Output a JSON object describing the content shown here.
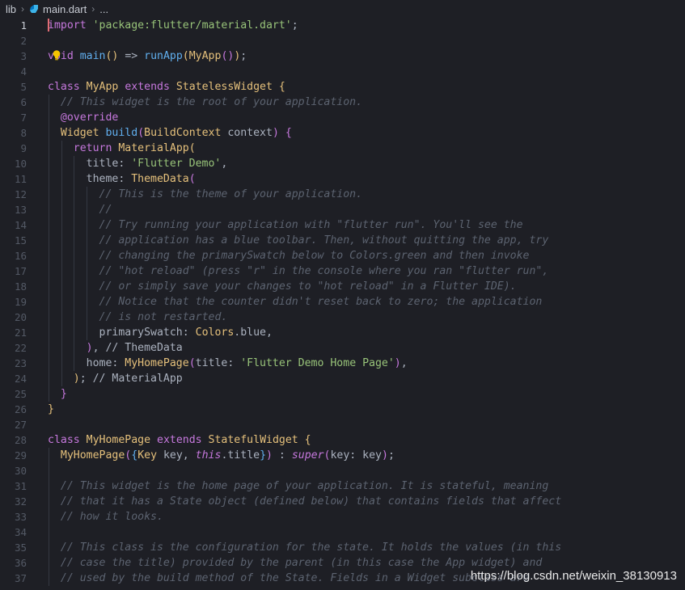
{
  "breadcrumb": {
    "folder": "lib",
    "file": "main.dart",
    "more": "..."
  },
  "editor": {
    "active_line": 1,
    "lines": [
      {
        "n": "1",
        "indent": 0,
        "tokens": [
          [
            "kw",
            "import"
          ],
          [
            "pl",
            " "
          ],
          [
            "str",
            "'package:flutter/material.dart'"
          ],
          [
            "pl",
            ";"
          ]
        ]
      },
      {
        "n": "2",
        "indent": 0,
        "tokens": []
      },
      {
        "n": "3",
        "indent": 0,
        "tokens": [
          [
            "kw",
            "void"
          ],
          [
            "pl",
            " "
          ],
          [
            "fn",
            "main"
          ],
          [
            "brk",
            "()"
          ],
          [
            "pl",
            " => "
          ],
          [
            "fn",
            "runApp"
          ],
          [
            "brk",
            "("
          ],
          [
            "cls",
            "MyApp"
          ],
          [
            "brk2",
            "()"
          ],
          [
            "brk",
            ")"
          ],
          [
            "pl",
            ";"
          ]
        ]
      },
      {
        "n": "4",
        "indent": 0,
        "tokens": []
      },
      {
        "n": "5",
        "indent": 0,
        "tokens": [
          [
            "kw",
            "class"
          ],
          [
            "pl",
            " "
          ],
          [
            "cls",
            "MyApp"
          ],
          [
            "pl",
            " "
          ],
          [
            "kw",
            "extends"
          ],
          [
            "pl",
            " "
          ],
          [
            "cls",
            "StatelessWidget"
          ],
          [
            "pl",
            " "
          ],
          [
            "brk",
            "{"
          ]
        ]
      },
      {
        "n": "6",
        "indent": 1,
        "tokens": [
          [
            "cm",
            "// This widget is the root of your application."
          ]
        ]
      },
      {
        "n": "7",
        "indent": 1,
        "tokens": [
          [
            "ann",
            "@override"
          ]
        ]
      },
      {
        "n": "8",
        "indent": 1,
        "tokens": [
          [
            "cls",
            "Widget"
          ],
          [
            "pl",
            " "
          ],
          [
            "fn",
            "build"
          ],
          [
            "brk2",
            "("
          ],
          [
            "cls",
            "BuildContext"
          ],
          [
            "pl",
            " context"
          ],
          [
            "brk2",
            ")"
          ],
          [
            "pl",
            " "
          ],
          [
            "brk2",
            "{"
          ]
        ]
      },
      {
        "n": "9",
        "indent": 2,
        "tokens": [
          [
            "kw",
            "return"
          ],
          [
            "pl",
            " "
          ],
          [
            "cls",
            "MaterialApp"
          ],
          [
            "brk",
            "("
          ]
        ]
      },
      {
        "n": "10",
        "indent": 3,
        "tokens": [
          [
            "pl",
            "title: "
          ],
          [
            "str",
            "'Flutter Demo'"
          ],
          [
            "pl",
            ","
          ]
        ]
      },
      {
        "n": "11",
        "indent": 3,
        "tokens": [
          [
            "pl",
            "theme: "
          ],
          [
            "cls",
            "ThemeData"
          ],
          [
            "brk2",
            "("
          ]
        ]
      },
      {
        "n": "12",
        "indent": 4,
        "tokens": [
          [
            "cm",
            "// This is the theme of your application."
          ]
        ]
      },
      {
        "n": "13",
        "indent": 4,
        "tokens": [
          [
            "cm",
            "//"
          ]
        ]
      },
      {
        "n": "14",
        "indent": 4,
        "tokens": [
          [
            "cm",
            "// Try running your application with \"flutter run\". You'll see the"
          ]
        ]
      },
      {
        "n": "15",
        "indent": 4,
        "tokens": [
          [
            "cm",
            "// application has a blue toolbar. Then, without quitting the app, try"
          ]
        ]
      },
      {
        "n": "16",
        "indent": 4,
        "tokens": [
          [
            "cm",
            "// changing the primarySwatch below to Colors.green and then invoke"
          ]
        ]
      },
      {
        "n": "17",
        "indent": 4,
        "tokens": [
          [
            "cm",
            "// \"hot reload\" (press \"r\" in the console where you ran \"flutter run\","
          ]
        ]
      },
      {
        "n": "18",
        "indent": 4,
        "tokens": [
          [
            "cm",
            "// or simply save your changes to \"hot reload\" in a Flutter IDE)."
          ]
        ]
      },
      {
        "n": "19",
        "indent": 4,
        "tokens": [
          [
            "cm",
            "// Notice that the counter didn't reset back to zero; the application"
          ]
        ]
      },
      {
        "n": "20",
        "indent": 4,
        "tokens": [
          [
            "cm",
            "// is not restarted."
          ]
        ]
      },
      {
        "n": "21",
        "indent": 4,
        "tokens": [
          [
            "pl",
            "primarySwatch: "
          ],
          [
            "cls",
            "Colors"
          ],
          [
            "pl",
            ".blue,"
          ]
        ]
      },
      {
        "n": "22",
        "indent": 3,
        "tokens": [
          [
            "brk2",
            ")"
          ],
          [
            "pl",
            ", // ThemeData"
          ]
        ]
      },
      {
        "n": "23",
        "indent": 3,
        "tokens": [
          [
            "pl",
            "home: "
          ],
          [
            "cls",
            "MyHomePage"
          ],
          [
            "brk2",
            "("
          ],
          [
            "pl",
            "title: "
          ],
          [
            "str",
            "'Flutter Demo Home Page'"
          ],
          [
            "brk2",
            ")"
          ],
          [
            "pl",
            ","
          ]
        ]
      },
      {
        "n": "24",
        "indent": 2,
        "tokens": [
          [
            "brk",
            ")"
          ],
          [
            "pl",
            "; // MaterialApp"
          ]
        ]
      },
      {
        "n": "25",
        "indent": 1,
        "tokens": [
          [
            "brk2",
            "}"
          ]
        ]
      },
      {
        "n": "26",
        "indent": 0,
        "tokens": [
          [
            "brk",
            "}"
          ]
        ]
      },
      {
        "n": "27",
        "indent": 0,
        "tokens": []
      },
      {
        "n": "28",
        "indent": 0,
        "tokens": [
          [
            "kw",
            "class"
          ],
          [
            "pl",
            " "
          ],
          [
            "cls",
            "MyHomePage"
          ],
          [
            "pl",
            " "
          ],
          [
            "kw",
            "extends"
          ],
          [
            "pl",
            " "
          ],
          [
            "cls",
            "StatefulWidget"
          ],
          [
            "pl",
            " "
          ],
          [
            "brk",
            "{"
          ]
        ]
      },
      {
        "n": "29",
        "indent": 1,
        "tokens": [
          [
            "cls",
            "MyHomePage"
          ],
          [
            "brk2",
            "("
          ],
          [
            "fn",
            "{"
          ],
          [
            "cls",
            "Key"
          ],
          [
            "pl",
            " key, "
          ],
          [
            "it",
            "this"
          ],
          [
            "pl",
            ".title"
          ],
          [
            "fn",
            "}"
          ],
          [
            "brk2",
            ")"
          ],
          [
            "pl",
            " : "
          ],
          [
            "it",
            "super"
          ],
          [
            "brk2",
            "("
          ],
          [
            "pl",
            "key: key"
          ],
          [
            "brk2",
            ")"
          ],
          [
            "pl",
            ";"
          ]
        ]
      },
      {
        "n": "30",
        "indent": 1,
        "tokens": []
      },
      {
        "n": "31",
        "indent": 1,
        "tokens": [
          [
            "cm",
            "// This widget is the home page of your application. It is stateful, meaning"
          ]
        ]
      },
      {
        "n": "32",
        "indent": 1,
        "tokens": [
          [
            "cm",
            "// that it has a State object (defined below) that contains fields that affect"
          ]
        ]
      },
      {
        "n": "33",
        "indent": 1,
        "tokens": [
          [
            "cm",
            "// how it looks."
          ]
        ]
      },
      {
        "n": "34",
        "indent": 1,
        "tokens": []
      },
      {
        "n": "35",
        "indent": 1,
        "tokens": [
          [
            "cm",
            "// This class is the configuration for the state. It holds the values (in this"
          ]
        ]
      },
      {
        "n": "36",
        "indent": 1,
        "tokens": [
          [
            "cm",
            "// case the title) provided by the parent (in this case the App widget) and"
          ]
        ]
      },
      {
        "n": "37",
        "indent": 1,
        "tokens": [
          [
            "cm",
            "// used by the build method of the State. Fields in a Widget subclass are"
          ]
        ]
      }
    ]
  },
  "watermark": "https://blog.csdn.net/weixin_38130913",
  "colors": {
    "background": "#1e1f25",
    "keyword": "#c678dd",
    "string": "#98c379",
    "function": "#61afef",
    "class": "#e5c07b",
    "comment": "#5c6370"
  },
  "icons": [
    "chevron-right-icon",
    "dart-file-icon",
    "lightbulb-icon"
  ]
}
